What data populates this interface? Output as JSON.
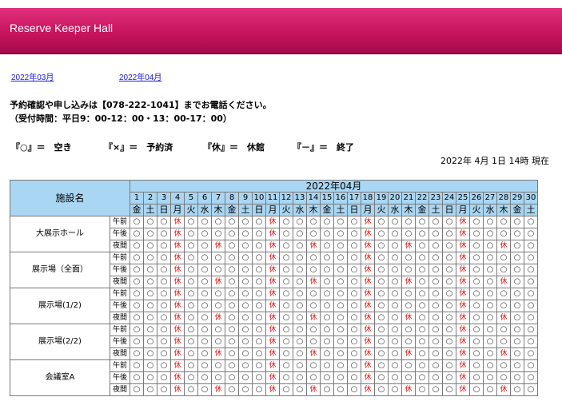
{
  "header": {
    "title": "Reserve Keeper Hall"
  },
  "month_links": [
    "2022年03月",
    "2022年04月"
  ],
  "notice": {
    "line1": "予約確認や申し込みは【078-222-1041】までお電話ください。",
    "line2": "（受付時間：平日9：00-12：00・13：00-17：00）"
  },
  "legend": [
    "『○』＝　空き",
    "『×』＝　予約済",
    "『休』＝　休館",
    "『－』＝　終了"
  ],
  "timestamp": "2022年 4月 1日 14時 現在",
  "calendar": {
    "facility_header": "施設名",
    "month_label": "2022年04月",
    "days": [
      "1",
      "2",
      "3",
      "4",
      "5",
      "6",
      "7",
      "8",
      "9",
      "10",
      "11",
      "12",
      "13",
      "14",
      "15",
      "16",
      "17",
      "18",
      "19",
      "20",
      "21",
      "22",
      "23",
      "24",
      "25",
      "26",
      "27",
      "28",
      "29",
      "30"
    ],
    "weekdays": [
      "金",
      "土",
      "日",
      "月",
      "火",
      "水",
      "木",
      "金",
      "土",
      "日",
      "月",
      "火",
      "水",
      "木",
      "金",
      "土",
      "日",
      "月",
      "火",
      "水",
      "木",
      "金",
      "土",
      "日",
      "月",
      "火",
      "水",
      "木",
      "金",
      "土"
    ],
    "slots": [
      "午前",
      "午後",
      "夜間"
    ],
    "symbols": {
      "open": "○",
      "closed": "休"
    },
    "facilities": [
      {
        "name": "大展示ホール",
        "rows": [
          [
            0,
            0,
            0,
            1,
            0,
            0,
            0,
            0,
            0,
            0,
            1,
            0,
            0,
            0,
            0,
            0,
            0,
            1,
            0,
            0,
            0,
            0,
            0,
            0,
            1,
            0,
            0,
            0,
            0,
            0
          ],
          [
            0,
            0,
            0,
            1,
            0,
            0,
            0,
            0,
            0,
            0,
            1,
            0,
            0,
            0,
            0,
            0,
            0,
            1,
            0,
            0,
            0,
            0,
            0,
            0,
            1,
            0,
            0,
            0,
            0,
            0
          ],
          [
            0,
            0,
            0,
            1,
            0,
            0,
            1,
            0,
            0,
            0,
            1,
            0,
            0,
            1,
            0,
            0,
            0,
            1,
            0,
            0,
            1,
            0,
            0,
            0,
            1,
            0,
            0,
            1,
            0,
            0
          ]
        ]
      },
      {
        "name": "展示場（全面）",
        "rows": [
          [
            0,
            0,
            0,
            1,
            0,
            0,
            0,
            0,
            0,
            0,
            1,
            0,
            0,
            0,
            0,
            0,
            0,
            1,
            0,
            0,
            0,
            0,
            0,
            0,
            1,
            0,
            0,
            0,
            0,
            0
          ],
          [
            0,
            0,
            0,
            1,
            0,
            0,
            0,
            0,
            0,
            0,
            1,
            0,
            0,
            0,
            0,
            0,
            0,
            1,
            0,
            0,
            0,
            0,
            0,
            0,
            1,
            0,
            0,
            0,
            0,
            0
          ],
          [
            0,
            0,
            0,
            1,
            0,
            0,
            1,
            0,
            0,
            0,
            1,
            0,
            0,
            1,
            0,
            0,
            0,
            1,
            0,
            0,
            1,
            0,
            0,
            0,
            1,
            0,
            0,
            1,
            0,
            0
          ]
        ]
      },
      {
        "name": "展示場(1/2)",
        "rows": [
          [
            0,
            0,
            0,
            1,
            0,
            0,
            0,
            0,
            0,
            0,
            1,
            0,
            0,
            0,
            0,
            0,
            0,
            1,
            0,
            0,
            0,
            0,
            0,
            0,
            1,
            0,
            0,
            0,
            0,
            0
          ],
          [
            0,
            0,
            0,
            1,
            0,
            0,
            0,
            0,
            0,
            0,
            1,
            0,
            0,
            0,
            0,
            0,
            0,
            1,
            0,
            0,
            0,
            0,
            0,
            0,
            1,
            0,
            0,
            0,
            0,
            0
          ],
          [
            0,
            0,
            0,
            1,
            0,
            0,
            1,
            0,
            0,
            0,
            1,
            0,
            0,
            1,
            0,
            0,
            0,
            1,
            0,
            0,
            1,
            0,
            0,
            0,
            1,
            0,
            0,
            1,
            0,
            0
          ]
        ]
      },
      {
        "name": "展示場(2/2)",
        "rows": [
          [
            0,
            0,
            0,
            1,
            0,
            0,
            0,
            0,
            0,
            0,
            1,
            0,
            0,
            0,
            0,
            0,
            0,
            1,
            0,
            0,
            0,
            0,
            0,
            0,
            1,
            0,
            0,
            0,
            0,
            0
          ],
          [
            0,
            0,
            0,
            1,
            0,
            0,
            0,
            0,
            0,
            0,
            1,
            0,
            0,
            0,
            0,
            0,
            0,
            1,
            0,
            0,
            0,
            0,
            0,
            0,
            1,
            0,
            0,
            0,
            0,
            0
          ],
          [
            0,
            0,
            0,
            1,
            0,
            0,
            1,
            0,
            0,
            0,
            1,
            0,
            0,
            1,
            0,
            0,
            0,
            1,
            0,
            0,
            1,
            0,
            0,
            0,
            1,
            0,
            0,
            1,
            0,
            0
          ]
        ]
      },
      {
        "name": "会議室A",
        "rows": [
          [
            0,
            0,
            0,
            1,
            0,
            0,
            0,
            0,
            0,
            0,
            1,
            0,
            0,
            0,
            0,
            0,
            0,
            1,
            0,
            0,
            0,
            0,
            0,
            0,
            1,
            0,
            0,
            0,
            0,
            0
          ],
          [
            0,
            0,
            0,
            1,
            0,
            0,
            0,
            0,
            0,
            0,
            1,
            0,
            0,
            0,
            0,
            0,
            0,
            1,
            0,
            0,
            0,
            0,
            0,
            0,
            1,
            0,
            0,
            0,
            0,
            0
          ],
          [
            0,
            0,
            0,
            1,
            0,
            0,
            1,
            0,
            0,
            0,
            1,
            0,
            0,
            1,
            0,
            0,
            0,
            1,
            0,
            0,
            1,
            0,
            0,
            0,
            1,
            0,
            0,
            1,
            0,
            0
          ]
        ]
      }
    ]
  }
}
